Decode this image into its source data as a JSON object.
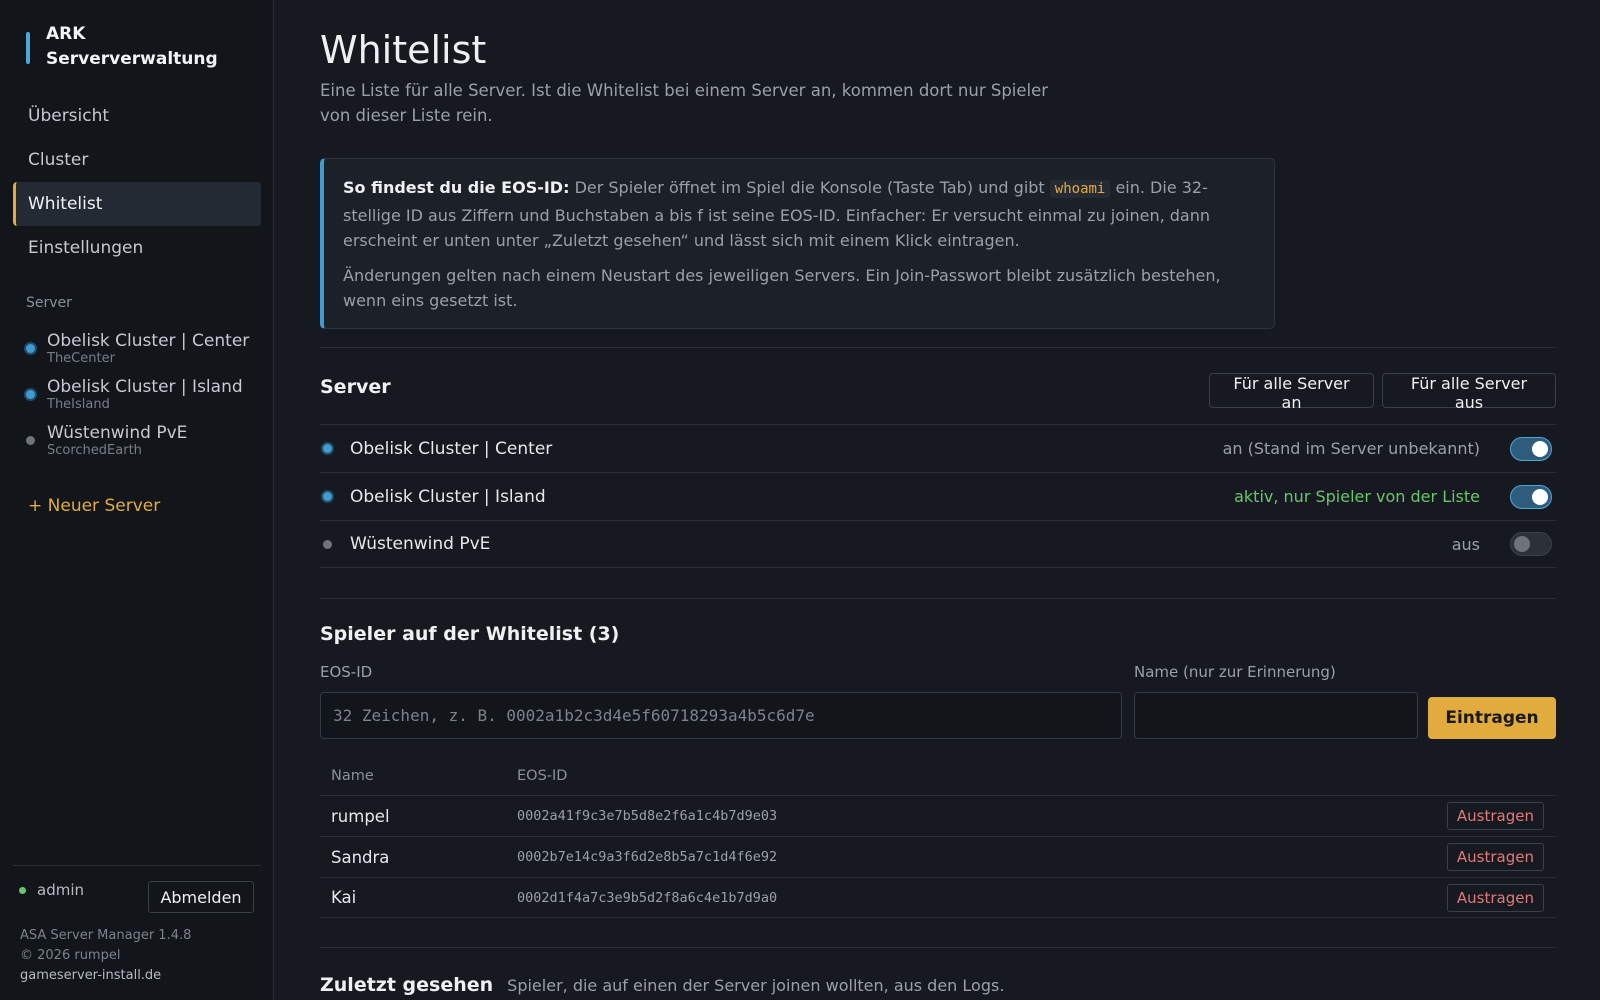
{
  "brand": {
    "line1": "ARK",
    "line2": "Serververwaltung"
  },
  "nav": [
    {
      "label": "Übersicht"
    },
    {
      "label": "Cluster"
    },
    {
      "label": "Whitelist"
    },
    {
      "label": "Einstellungen"
    }
  ],
  "sidebar_servers": {
    "heading": "Server",
    "items": [
      {
        "name": "Obelisk Cluster | Center",
        "map": "TheCenter",
        "status": "on"
      },
      {
        "name": "Obelisk Cluster | Island",
        "map": "TheIsland",
        "status": "on"
      },
      {
        "name": "Wüstenwind PvE",
        "map": "ScorchedEarth",
        "status": "off"
      }
    ],
    "new_server": "+ Neuer Server"
  },
  "user": {
    "name": "admin",
    "logout": "Abmelden"
  },
  "footer": {
    "version": "ASA Server Manager 1.4.8",
    "copyright": "© 2026 rumpel",
    "link": "gameserver-install.de"
  },
  "page": {
    "title": "Whitelist",
    "subtitle": "Eine Liste für alle Server. Ist die Whitelist bei einem Server an, kommen dort nur Spieler von dieser Liste rein."
  },
  "info": {
    "bold": "So findest du die EOS-ID:",
    "text1": " Der Spieler öffnet im Spiel die Konsole (Taste Tab) und gibt ",
    "code": "whoami",
    "text2": " ein. Die 32-stellige ID aus Ziffern und Buchstaben a bis f ist seine EOS-ID. Einfacher: Er versucht einmal zu joinen, dann erscheint er unten unter „Zuletzt gesehen“ und lässt sich mit einem Klick eintragen.",
    "para2": "Änderungen gelten nach einem Neustart des jeweiligen Servers. Ein Join-Passwort bleibt zusätzlich bestehen, wenn eins gesetzt ist."
  },
  "servers_section": {
    "title": "Server",
    "all_on": "Für alle Server an",
    "all_off": "Für alle Server aus",
    "rows": [
      {
        "name": "Obelisk Cluster | Center",
        "state": "an (Stand im Server unbekannt)",
        "toggle": "on"
      },
      {
        "name": "Obelisk Cluster | Island",
        "state": "aktiv, nur Spieler von der Liste",
        "toggle": "on"
      },
      {
        "name": "Wüstenwind PvE",
        "state": "aus",
        "toggle": "off"
      }
    ]
  },
  "whitelist": {
    "title": "Spieler auf der Whitelist (3)",
    "eos_label": "EOS-ID",
    "eos_placeholder": "32 Zeichen, z. B. 0002a1b2c3d4e5f60718293a4b5c6d7e",
    "name_label": "Name (nur zur Erinnerung)",
    "name_value": "",
    "submit": "Eintragen",
    "columns": [
      "Name",
      "EOS-ID"
    ],
    "remove_label": "Austragen",
    "rows": [
      {
        "name": "rumpel",
        "id": "0002a41f9c3e7b5d8e2f6a1c4b7d9e03"
      },
      {
        "name": "Sandra",
        "id": "0002b7e14c9a3f6d2e8b5a7c1d4f6e92"
      },
      {
        "name": "Kai",
        "id": "0002d1f4a7c3e9b5d2f8a6c4e1b7d9a0"
      }
    ]
  },
  "recent": {
    "title": "Zuletzt gesehen",
    "desc": "Spieler, die auf einen der Server joinen wollten, aus den Logs."
  },
  "colors": {
    "accent": "#e2ab3e",
    "blue": "#3f9bd0",
    "green": "#6cc36f",
    "danger": "#e07a7a"
  }
}
